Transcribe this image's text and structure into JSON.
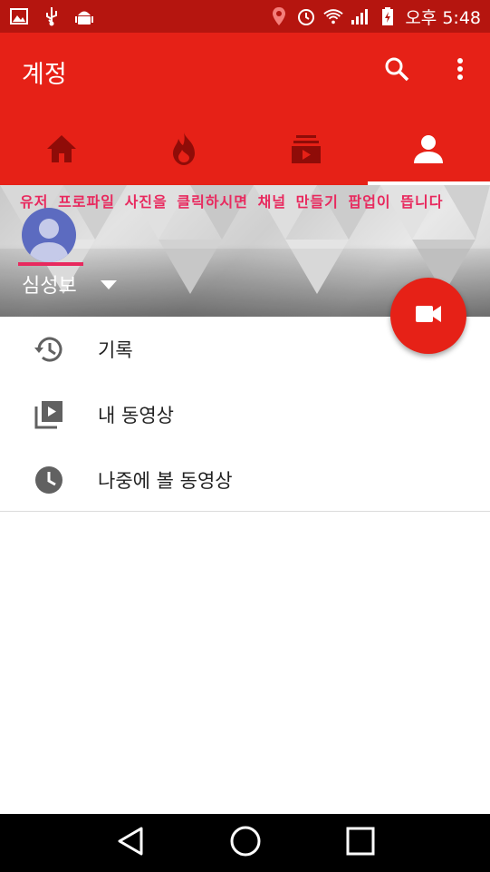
{
  "status_bar": {
    "time": "오후 5:48",
    "icons": [
      "gallery-icon",
      "usb-icon",
      "android-icon",
      "location-icon",
      "alarm-icon",
      "wifi-icon",
      "signal-icon",
      "battery-icon"
    ]
  },
  "app_bar": {
    "title": "계정",
    "actions": [
      "search-icon",
      "more-vert-icon"
    ]
  },
  "tabs": [
    {
      "name": "home",
      "icon": "home-icon",
      "active": false
    },
    {
      "name": "trending",
      "icon": "flame-icon",
      "active": false
    },
    {
      "name": "subscriptions",
      "icon": "subscriptions-icon",
      "active": false
    },
    {
      "name": "account",
      "icon": "account-icon",
      "active": true
    }
  ],
  "banner": {
    "overlay_text": "유저 프로파일 사진을 클릭하시면 채널 만들기 팝업이 뜹니다",
    "username": "심성보"
  },
  "menu": [
    {
      "label": "기록",
      "icon": "history-icon"
    },
    {
      "label": "내 동영상",
      "icon": "my-videos-icon"
    },
    {
      "label": "나중에 볼 동영상",
      "icon": "watch-later-icon"
    }
  ],
  "colors": {
    "accent": "#e62117",
    "status_bar": "#b5150f",
    "overlay_text": "#e8295e"
  }
}
